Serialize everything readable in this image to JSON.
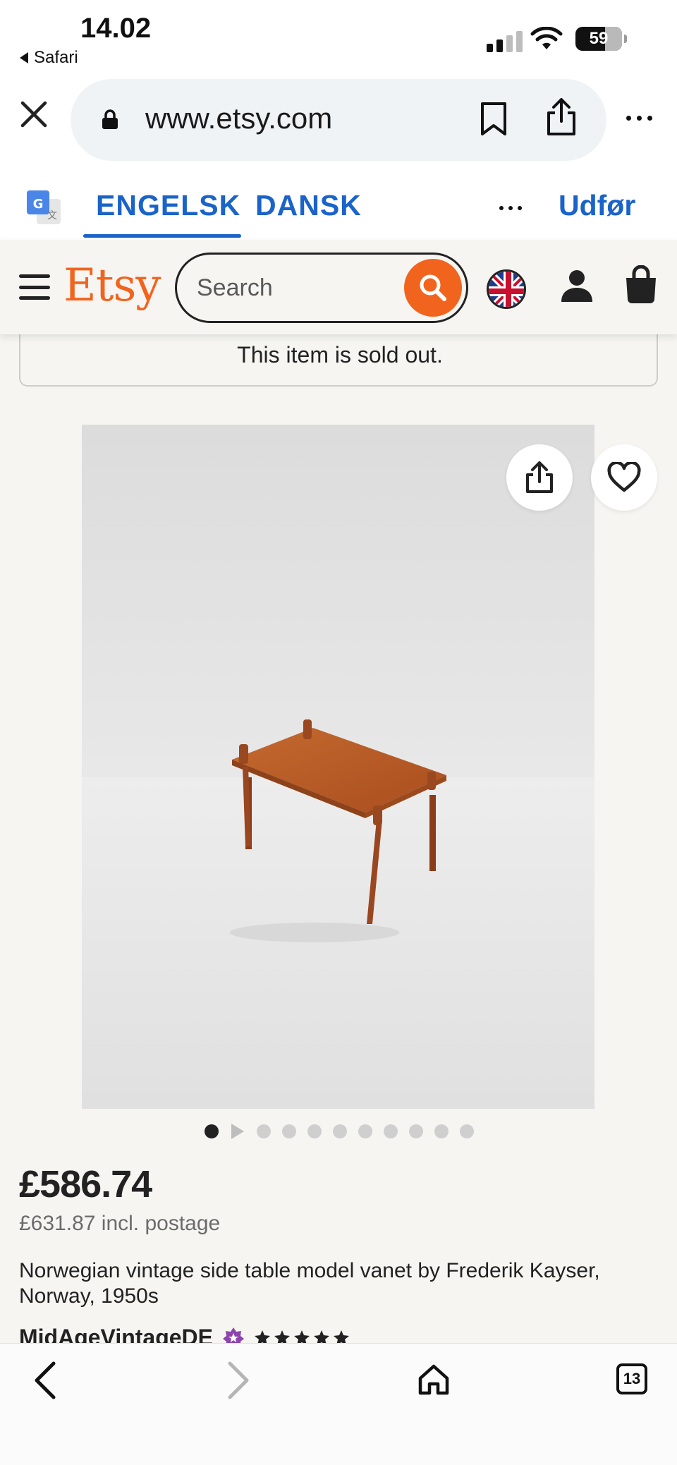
{
  "status_bar": {
    "time": "14.02",
    "back_app": "Safari",
    "battery": "59"
  },
  "browser": {
    "url": "www.etsy.com",
    "tabs_count": "13"
  },
  "translate_bar": {
    "lang_active": "ENGELSK",
    "lang_other": "DANSK",
    "action": "Udfør"
  },
  "header": {
    "logo": "Etsy",
    "search_placeholder": "Search"
  },
  "listing": {
    "sold_out_notice": "This item is sold out.",
    "price": "£586.74",
    "price_with_postage": "£631.87 incl. postage",
    "title": "Norwegian vintage side table model vanet by Frederik Kayser, Norway, 1950s",
    "shop_name": "MidAgeVintageDE",
    "rating_stars": 5,
    "image_count": 11,
    "current_image": 1
  },
  "colors": {
    "etsy_orange": "#f1641e",
    "translate_blue": "#1a63c9",
    "page_bg": "#f6f5f2"
  }
}
